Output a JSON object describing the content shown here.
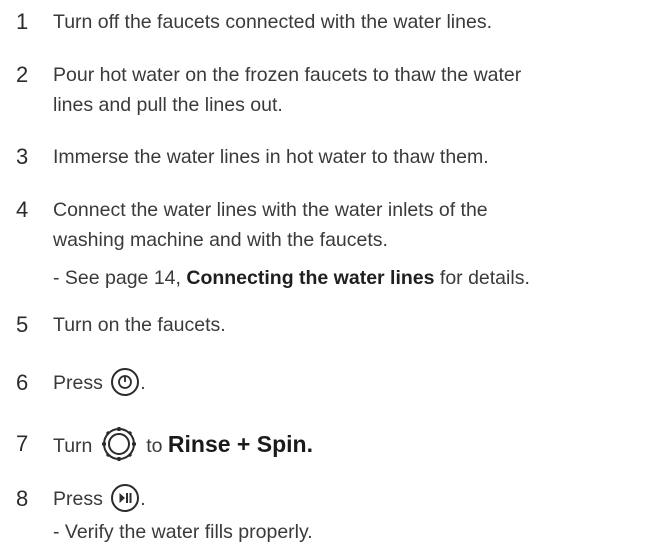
{
  "steps": [
    {
      "num": "1",
      "text": "Turn off the faucets connected with the water lines."
    },
    {
      "num": "2",
      "text_line1": "Pour hot water on the frozen faucets to thaw the water",
      "text_line2": "lines and pull the lines out."
    },
    {
      "num": "3",
      "text": "Immerse the water lines in hot water to thaw them."
    },
    {
      "num": "4",
      "text_line1": "Connect the water lines with the water inlets of the",
      "text_line2": "washing machine and with the faucets.",
      "note_prefix": "- See page 14, ",
      "note_link": "Connecting the water lines",
      "note_suffix": " for details."
    },
    {
      "num": "5",
      "text": "Turn on the faucets."
    },
    {
      "num": "6",
      "text_prefix": "Press ",
      "text_suffix": ".",
      "icon": "power-button-icon"
    },
    {
      "num": "7",
      "text_prefix": "Turn ",
      "text_middle": " to ",
      "text_bold": "Rinse + Spin.",
      "icon": "program-dial-icon"
    },
    {
      "num": "8",
      "text_prefix": "Press ",
      "text_suffix": ".",
      "icon": "start-pause-button-icon",
      "note": "- Verify the water fills properly."
    }
  ]
}
